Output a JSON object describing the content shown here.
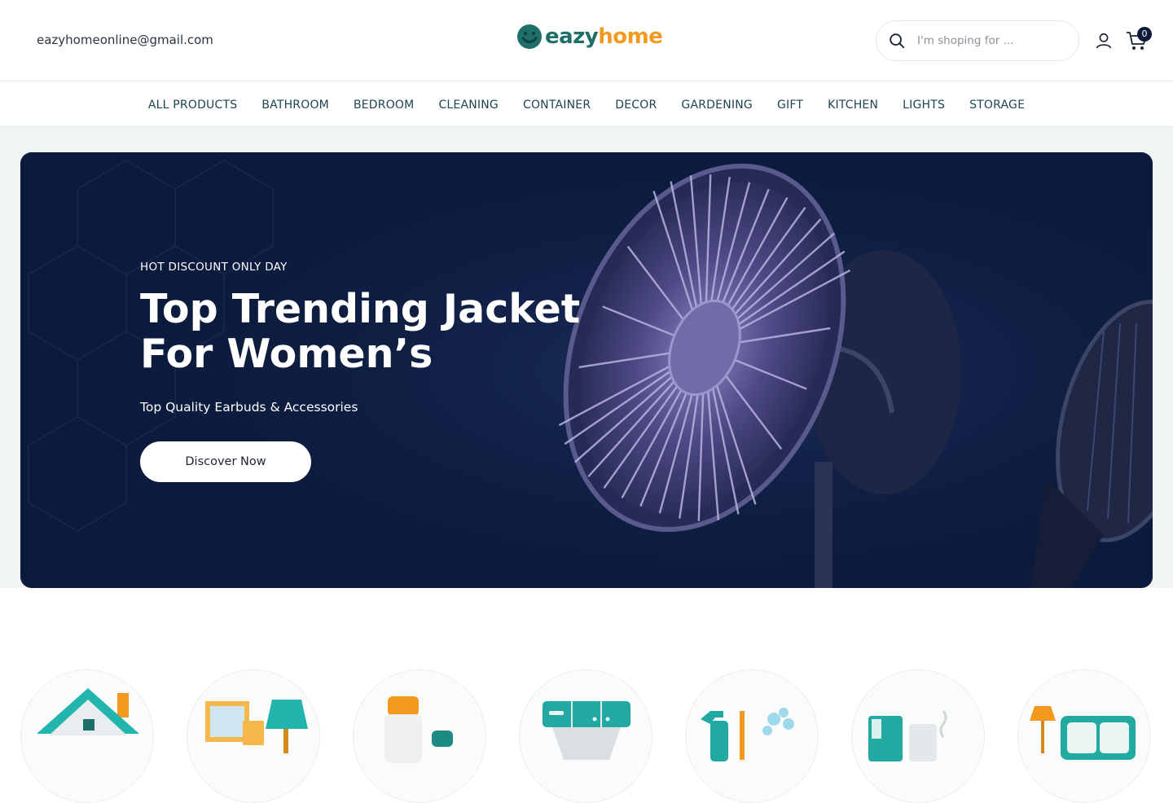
{
  "header": {
    "email": "eazyhomeonline@gmail.com",
    "logo_part1": "eazy",
    "logo_part2": "home",
    "search_placeholder": "I'm shoping for ...",
    "cart_count": "0",
    "icons": [
      "search-icon",
      "user-icon",
      "cart-icon"
    ]
  },
  "nav": {
    "items": [
      "ALL PRODUCTS",
      "BATHROOM",
      "BEDROOM",
      "CLEANING",
      "CONTAINER",
      "DECOR",
      "GARDENING",
      "GIFT",
      "KITCHEN",
      "LIGHTS",
      "STORAGE"
    ]
  },
  "hero": {
    "kicker": "HOT DISCOUNT ONLY DAY",
    "title_line1": "Top Trending Jacket",
    "title_line2": "For Women’s",
    "subtitle": "Top Quality Earbuds & Accessories",
    "button": "Discover Now"
  },
  "categories": {
    "icons": [
      "house-icon",
      "decor-picture-lamp-icon",
      "bottle-container-icon",
      "cabinet-storage-icon",
      "cleaning-spray-icon",
      "kitchen-appliance-icon",
      "lamp-furniture-icon"
    ]
  },
  "colors": {
    "brand_teal": "#1e6e6a",
    "brand_orange": "#f39a1e",
    "hero_bg": "#0c1b3d",
    "nav_text": "#1d4450"
  }
}
